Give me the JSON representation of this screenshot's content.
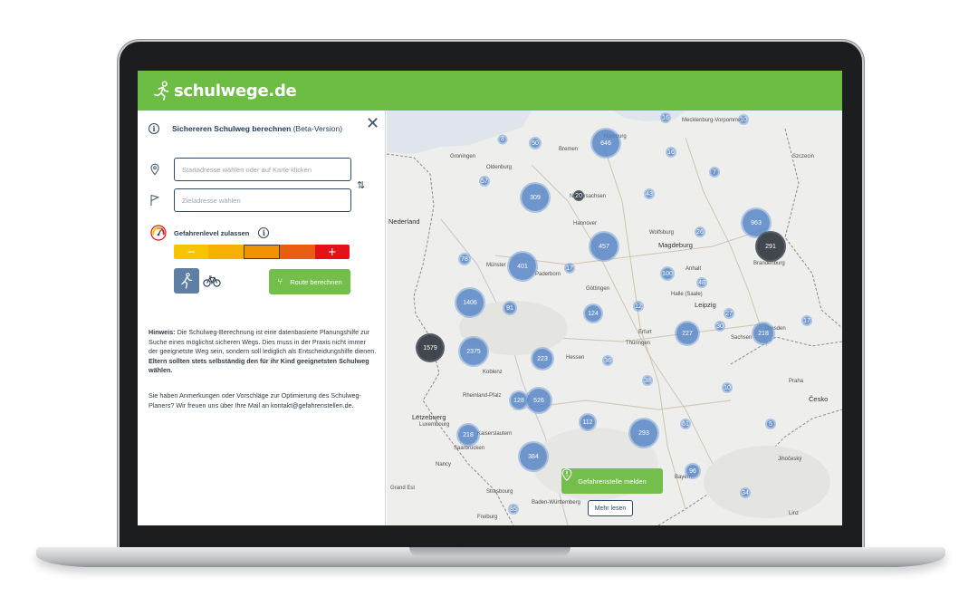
{
  "app": {
    "logo_text": "schulwege.de"
  },
  "panel": {
    "title_bold": "Sichereren Schulweg berechnen",
    "title_suffix": "(Beta-Version)",
    "start_placeholder": "Startadresse wählen oder auf Karte klicken",
    "target_placeholder": "Zieladresse wählen",
    "danger_label": "Gefahrenlevel zulassen",
    "danger_minus": "−",
    "danger_plus": "+",
    "danger_level_selected": 3,
    "danger_level_max": 5,
    "route_button": "Route berechnen",
    "hint_label": "Hinweis:",
    "hint_text": "Die Schulweg-Berechnung ist eine datenbasierte Planungshilfe zur Suche eines möglichst sicheren Wegs. Dies muss in der Praxis nicht immer der geeignetste Weg sein, sondern soll lediglich als Entscheidungshilfe dienen.",
    "hint_bold": "Eltern sollten stets selbständig den für ihr Kind geeignetsten Schulweg wählen.",
    "feedback_text": "Sie haben Anmerkungen oder Vorschläge zur Optimierung des Schulweg-Planers? Wir freuen uns über Ihre Mail an kontakt@gefahrenstellen.de."
  },
  "map": {
    "report_button": "Gefahrenstelle melden",
    "more_button": "Mehr lesen",
    "clusters": [
      {
        "label": "8"
      },
      {
        "label": "50"
      },
      {
        "label": "646"
      },
      {
        "label": "16"
      },
      {
        "label": "10"
      },
      {
        "label": "16"
      },
      {
        "label": "57"
      },
      {
        "label": "309"
      },
      {
        "label": "20"
      },
      {
        "label": "43"
      },
      {
        "label": "7"
      },
      {
        "label": "963"
      },
      {
        "label": "291"
      },
      {
        "label": "26"
      },
      {
        "label": "457"
      },
      {
        "label": "78"
      },
      {
        "label": "401"
      },
      {
        "label": "17"
      },
      {
        "label": "100"
      },
      {
        "label": "48"
      },
      {
        "label": "1406"
      },
      {
        "label": "91"
      },
      {
        "label": "124"
      },
      {
        "label": "12"
      },
      {
        "label": "27"
      },
      {
        "label": "30"
      },
      {
        "label": "227"
      },
      {
        "label": "218"
      },
      {
        "label": "17"
      },
      {
        "label": "1579"
      },
      {
        "label": "2375"
      },
      {
        "label": "223"
      },
      {
        "label": "36"
      },
      {
        "label": "38"
      },
      {
        "label": "128"
      },
      {
        "label": "526"
      },
      {
        "label": "10"
      },
      {
        "label": "5"
      },
      {
        "label": "112"
      },
      {
        "label": "61"
      },
      {
        "label": "293"
      },
      {
        "label": "218"
      },
      {
        "label": "384"
      },
      {
        "label": "96"
      },
      {
        "label": "34"
      },
      {
        "label": "85"
      }
    ],
    "places": [
      {
        "label": "Groningen"
      },
      {
        "label": "Oldenburg"
      },
      {
        "label": "Bremen"
      },
      {
        "label": "Hamburg"
      },
      {
        "label": "Niedersachsen"
      },
      {
        "label": "Hannover"
      },
      {
        "label": "Wolfsburg"
      },
      {
        "label": "Magdeburg"
      },
      {
        "label": "Brandenburg"
      },
      {
        "label": "Münster"
      },
      {
        "label": "Paderborn"
      },
      {
        "label": "Göttingen"
      },
      {
        "label": "Halle (Saale)"
      },
      {
        "label": "Leipzig"
      },
      {
        "label": "Dresden"
      },
      {
        "label": "Erfurt"
      },
      {
        "label": "Thüringen"
      },
      {
        "label": "Hessen"
      },
      {
        "label": "Koblenz"
      },
      {
        "label": "Rheinland-Pfalz"
      },
      {
        "label": "Luxembourg"
      },
      {
        "label": "Saarbrücken"
      },
      {
        "label": "Kaiserslautern"
      },
      {
        "label": "Strasbourg"
      },
      {
        "label": "Baden-Württemberg"
      },
      {
        "label": "Bayern"
      },
      {
        "label": "Česko"
      },
      {
        "label": "Praha"
      },
      {
        "label": "Nederland"
      },
      {
        "label": "Lëtzebuerg"
      },
      {
        "label": "Szczecin"
      },
      {
        "label": "Mecklenburg-Vorpommern"
      },
      {
        "label": "Anhalt"
      },
      {
        "label": "Sachsen"
      },
      {
        "label": "Nancy"
      },
      {
        "label": "Grand Est"
      },
      {
        "label": "Freiburg"
      },
      {
        "label": "Linz"
      },
      {
        "label": "Jihočeský"
      }
    ]
  }
}
